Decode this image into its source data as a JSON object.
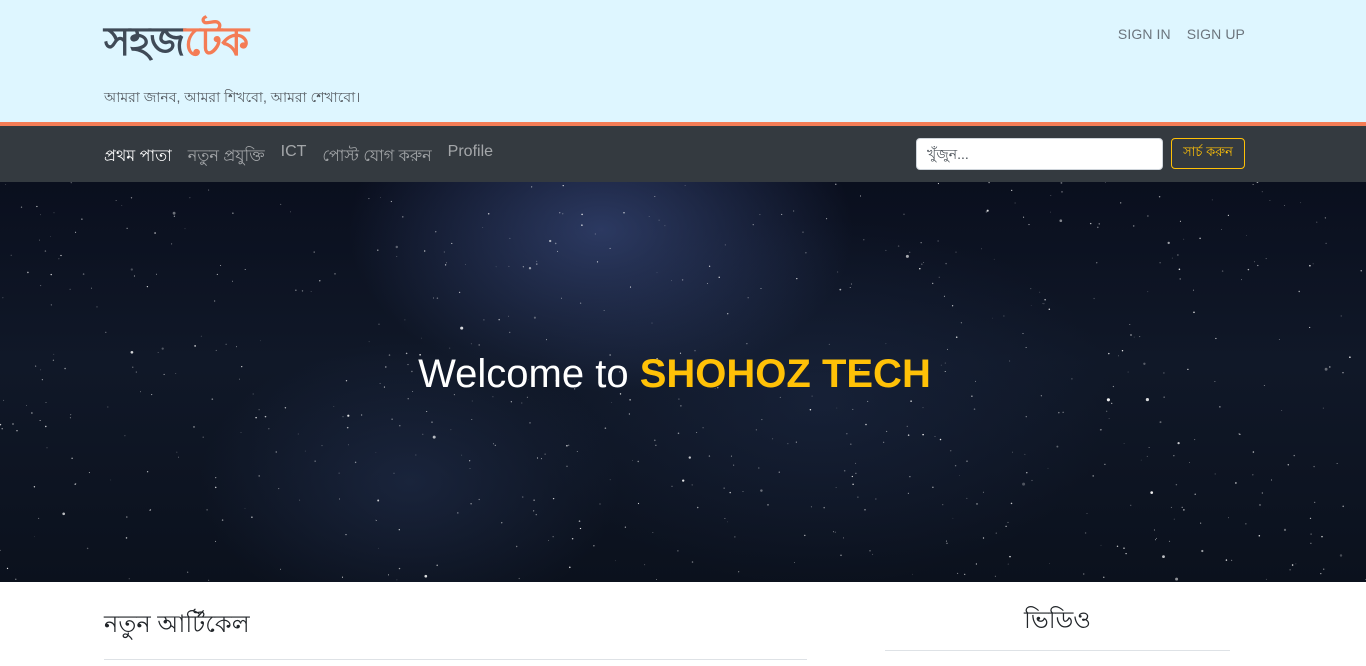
{
  "header": {
    "logo_part1": "সহজ",
    "logo_part2": "টেক",
    "tagline": "আমরা জানব, আমরা শিখবো, আমরা শেখাবো।",
    "auth_links": [
      "SIGN IN",
      "SIGN UP"
    ]
  },
  "navbar": {
    "items": [
      "প্রথম পাতা",
      "নতুন প্রযুক্তি",
      "ICT",
      "পোস্ট যোগ করুন",
      "Profile"
    ],
    "active_item": "প্রথম পাতা",
    "search_placeholder": "খুঁজুন...",
    "search_button": "সার্চ করুন"
  },
  "hero": {
    "title_prefix": "Welcome to",
    "title_brand": "SHOHOZ TECH"
  },
  "main": {
    "articles_heading": "নতুন আর্টিকেল",
    "video_heading": "ভিডিও"
  },
  "colors": {
    "topbar_bg": "#def6ff",
    "accent_orange": "#f47c55",
    "navbar_bg": "#343a40",
    "brand_yellow": "#ffc107"
  }
}
